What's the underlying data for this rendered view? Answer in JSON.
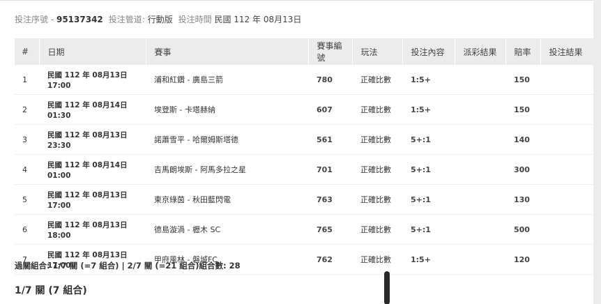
{
  "meta": {
    "serial_label": "投注序號 - ",
    "serial_value": "95137342",
    "channel_label": "投注管道: ",
    "channel_value": "行動版",
    "time_label": "投注時間 ",
    "time_value": "民國 112 年 08月13日"
  },
  "table": {
    "headers": {
      "no": "#",
      "date": "日期",
      "match": "賽事",
      "code": "賽事編號",
      "play": "玩法",
      "content": "投注內容",
      "result": "派彩結果",
      "odds": "賠率",
      "bet_result": "投注結果"
    },
    "rows": [
      {
        "no": "1",
        "date": "民國 112 年 08月13日",
        "time": "17:00",
        "match": "浦和紅鑽 - 廣島三箭",
        "code": "780",
        "play": "正確比數",
        "content": "1:5+",
        "result": "",
        "odds": "150",
        "bet_result": ""
      },
      {
        "no": "2",
        "date": "民國 112 年 08月14日",
        "time": "01:30",
        "match": "埃登斯 - 卡塔赫納",
        "code": "607",
        "play": "正確比數",
        "content": "1:5+",
        "result": "",
        "odds": "150",
        "bet_result": ""
      },
      {
        "no": "3",
        "date": "民國 112 年 08月13日",
        "time": "23:30",
        "match": "諾蕭雪平 - 哈爾姆斯塔德",
        "code": "561",
        "play": "正確比數",
        "content": "5+:1",
        "result": "",
        "odds": "140",
        "bet_result": ""
      },
      {
        "no": "4",
        "date": "民國 112 年 08月14日",
        "time": "01:00",
        "match": "吉馬朗埃斯 - 阿馬多拉之星",
        "code": "701",
        "play": "正確比數",
        "content": "5+:1",
        "result": "",
        "odds": "300",
        "bet_result": ""
      },
      {
        "no": "5",
        "date": "民國 112 年 08月13日",
        "time": "17:00",
        "match": "東京綠茵 - 秋田藍閃電",
        "code": "763",
        "play": "正確比數",
        "content": "5+:1",
        "result": "",
        "odds": "130",
        "bet_result": ""
      },
      {
        "no": "6",
        "date": "民國 112 年 08月13日",
        "time": "18:00",
        "match": "德島漩渦 - 櫪木 SC",
        "code": "765",
        "play": "正確比數",
        "content": "5+:1",
        "result": "",
        "odds": "500",
        "bet_result": ""
      },
      {
        "no": "7",
        "date": "民國 112 年 08月13日",
        "time": "17:00",
        "match": "甲府風林 - 磐城FC",
        "code": "762",
        "play": "正確比數",
        "content": "1:5+",
        "result": "",
        "odds": "120",
        "bet_result": ""
      }
    ]
  },
  "summary": "過關組合: 1/7 關 (=7 組合) | 2/7 關 (=21 組合)組合數: 28",
  "section_title": "1/7 關 (7 組合)"
}
